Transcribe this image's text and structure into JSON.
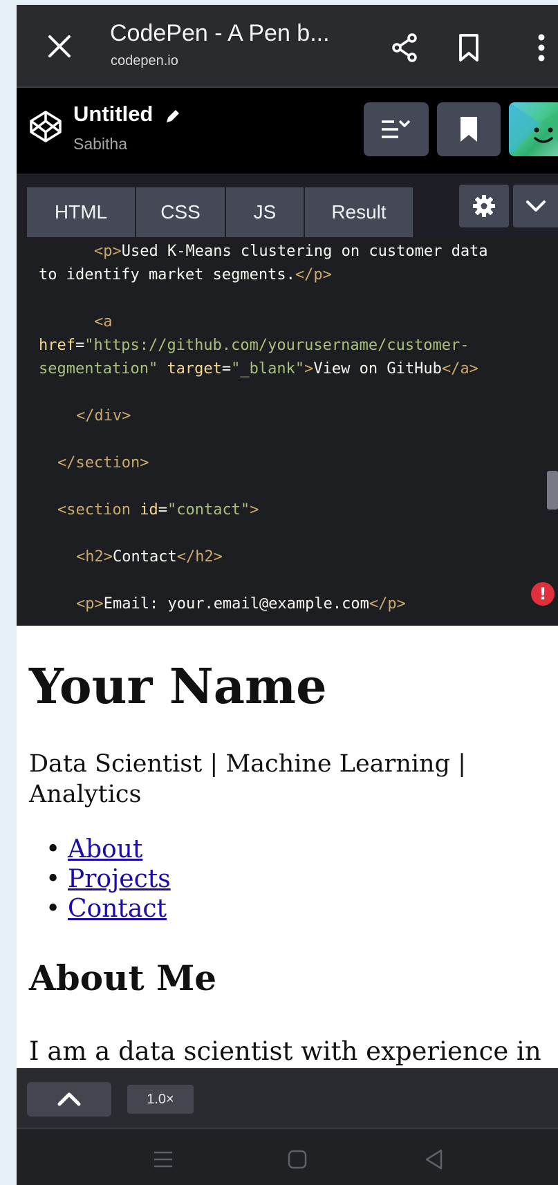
{
  "browser": {
    "title": "CodePen - A Pen b...",
    "url": "codepen.io",
    "icons": [
      "close-icon",
      "share-icon",
      "bookmark-icon",
      "more-vert-icon"
    ]
  },
  "codepen": {
    "pen_title": "Untitled",
    "author": "Sabitha",
    "icons": [
      "codepen-logo-icon",
      "pencil-icon",
      "layout-icon",
      "bookmark-icon",
      "avatar"
    ]
  },
  "tabs": [
    "HTML",
    "CSS",
    "JS",
    "Result"
  ],
  "code": {
    "l1_open": "<p>",
    "l1_text": "Used K-Means clustering on customer data",
    "l2_text": "to identify market segments.",
    "l2_close": "</p>",
    "l3_tag": "<a",
    "l4_attr": "href",
    "l4_eq": "=",
    "l4_val": "\"https://github.com/yourusername/customer-",
    "l5_val": "segmentation\"",
    "l5_attr": "target",
    "l5_eq": "=",
    "l5_val2": "\"_blank\"",
    "l5_gt": ">",
    "l5_text": "View on GitHub",
    "l5_close": "</a>",
    "l6": "</div>",
    "l7": "</section>",
    "l8_open": "<section",
    "l8_attr": "id",
    "l8_eq": "=",
    "l8_val": "\"contact\"",
    "l8_gt": ">",
    "l9_open": "<h2>",
    "l9_text": "Contact",
    "l9_close": "</h2>",
    "l10_open": "<p>",
    "l10_text": "Email: your.email@example.com",
    "l10_close": "</p>",
    "error_badge": "!"
  },
  "result": {
    "name": "Your Name",
    "subtitle": "Data Scientist | Machine Learning | Analytics",
    "nav": [
      "About",
      "Projects",
      "Contact"
    ],
    "about_heading": "About Me",
    "about_text": "I am a data scientist with experience in"
  },
  "bottom": {
    "zoom": "1.0×"
  },
  "system_nav": [
    "recents-icon",
    "home-icon",
    "back-icon"
  ],
  "colors": {
    "browser_bar": "#2a2b2f",
    "codepen_header": "#000000",
    "tab_bg": "#444857",
    "editor_bg": "#1d1e22",
    "tag": "#c8a96a",
    "attribute": "#f5d78a",
    "string": "#a9c07a",
    "link": "#1a0dab",
    "error": "#e0303c"
  }
}
